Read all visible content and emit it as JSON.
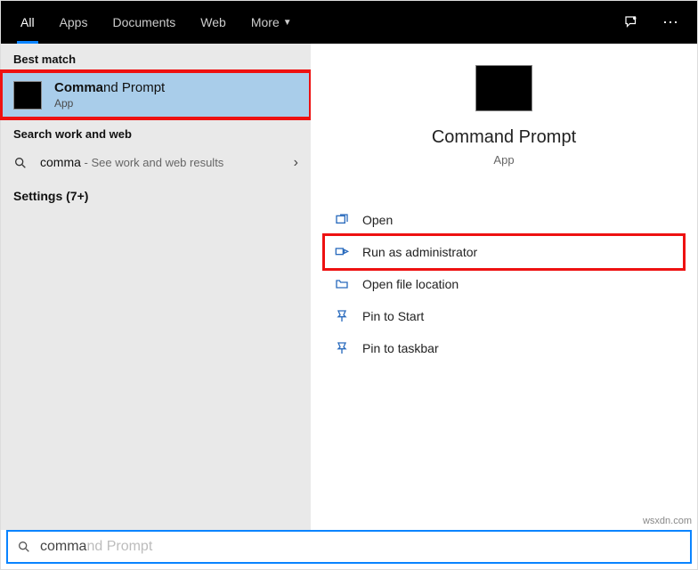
{
  "topbar": {
    "tabs": {
      "all": "All",
      "apps": "Apps",
      "documents": "Documents",
      "web": "Web",
      "more": "More"
    }
  },
  "left": {
    "best_match_header": "Best match",
    "best_match": {
      "title_bold": "Comma",
      "title_rest": "nd Prompt",
      "sub": "App"
    },
    "search_web_header": "Search work and web",
    "web_row": {
      "query": "comma",
      "rest": " - See work and web results"
    },
    "settings_label": "Settings (7+)"
  },
  "detail": {
    "title": "Command Prompt",
    "sub": "App",
    "actions": {
      "open": "Open",
      "run_admin": "Run as administrator",
      "open_loc": "Open file location",
      "pin_start": "Pin to Start",
      "pin_taskbar": "Pin to taskbar"
    }
  },
  "search": {
    "typed": "comma",
    "ghost": "nd Prompt"
  },
  "watermark": "wsxdn.com"
}
